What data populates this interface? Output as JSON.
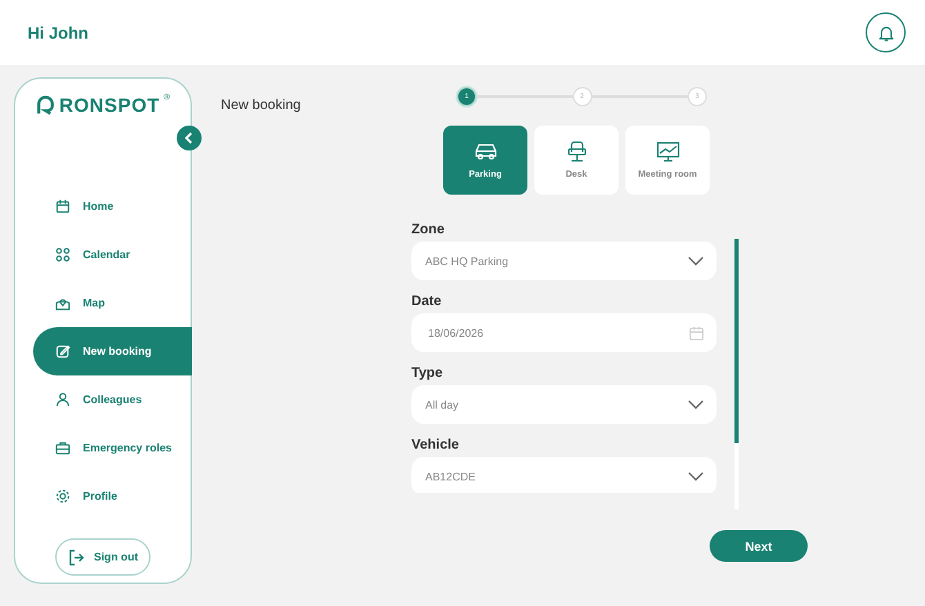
{
  "header": {
    "greeting": "Hi John"
  },
  "sidebar": {
    "logo": "RONSPOT",
    "logo_mark": "®",
    "items": [
      {
        "label": "Home",
        "selected": false
      },
      {
        "label": "Calendar",
        "selected": false
      },
      {
        "label": "Map",
        "selected": false
      },
      {
        "label": "New booking",
        "selected": true
      },
      {
        "label": "Colleagues",
        "selected": false
      },
      {
        "label": "Emergency roles",
        "selected": false
      },
      {
        "label": "Profile",
        "selected": false
      }
    ],
    "sign_out": "Sign out"
  },
  "page_title": "New booking",
  "steps": [
    {
      "label": "1",
      "selected": true
    },
    {
      "label": "2",
      "selected": false
    },
    {
      "label": "3",
      "selected": false
    }
  ],
  "categories": [
    {
      "label": "Parking",
      "selected": true
    },
    {
      "label": "Desk",
      "selected": false
    },
    {
      "label": "Meeting room",
      "selected": false
    }
  ],
  "fields": [
    {
      "label": "Zone",
      "kind": "select",
      "value": "ABC HQ Parking"
    },
    {
      "label": "Date",
      "kind": "date",
      "value": "18/06/2026"
    },
    {
      "label": "Type",
      "kind": "select",
      "value": "All day"
    },
    {
      "label": "Vehicle",
      "kind": "select",
      "value": "AB12CDE"
    }
  ],
  "next_button": "Next"
}
